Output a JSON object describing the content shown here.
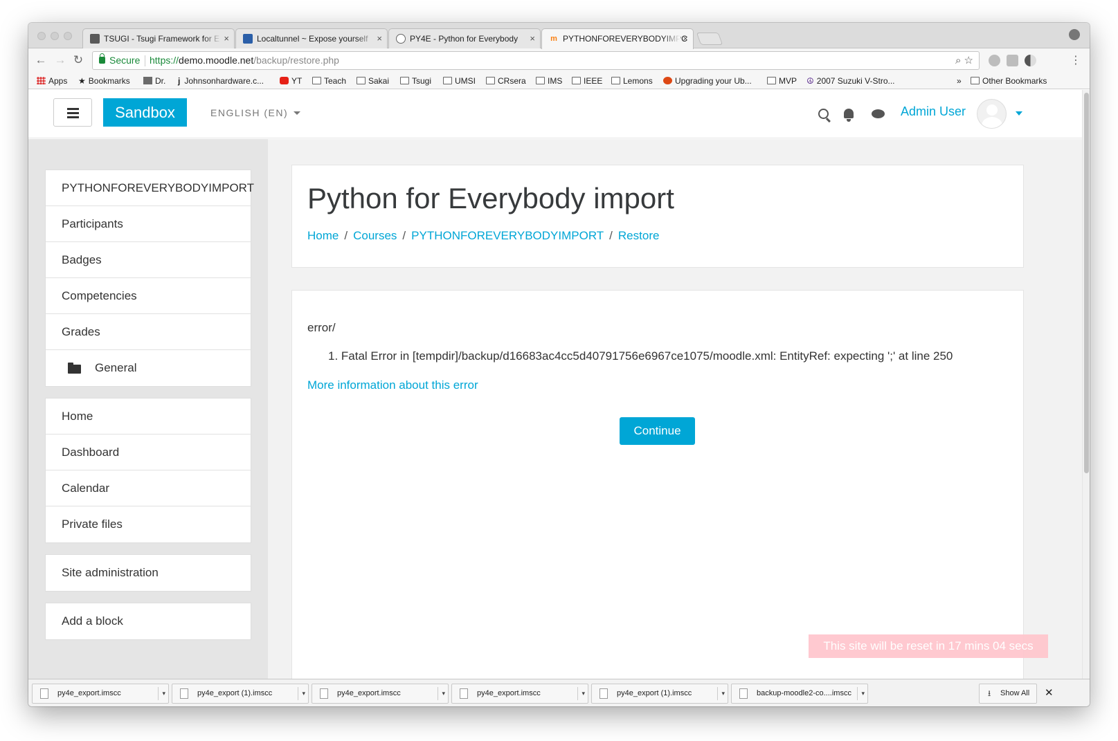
{
  "browser": {
    "tabs": [
      {
        "title": "TSUGI - Tsugi Framework for E",
        "favicon_color": "#5a5a5a"
      },
      {
        "title": "Localtunnel ~ Expose yourself",
        "favicon_color": "#2b5fa8"
      },
      {
        "title": "PY4E - Python for Everybody",
        "favicon_color": "#666666"
      },
      {
        "title": "PYTHONFOREVERYBODYIMPC",
        "favicon_color": "#f98012"
      }
    ],
    "close_glyph": "×",
    "nav": {
      "back": "←",
      "forward": "→",
      "reload": "↻"
    },
    "secure_label": "Secure",
    "url": {
      "scheme": "https://",
      "host": "demo.moodle.net",
      "path": "/backup/restore.php"
    },
    "omni_icons": "⌕ ☆",
    "kebab": "⋮",
    "bookmarks": [
      {
        "label": "Apps",
        "icon": "apps-icon"
      },
      {
        "label": "Bookmarks",
        "icon": "star-icon"
      },
      {
        "label": "Dr.",
        "icon": "photo-icon"
      },
      {
        "label": "Johnsonhardware.c...",
        "icon": "j-icon"
      },
      {
        "label": "YT",
        "icon": "youtube-icon"
      },
      {
        "label": "Teach",
        "icon": "folder-icon"
      },
      {
        "label": "Sakai",
        "icon": "folder-icon"
      },
      {
        "label": "Tsugi",
        "icon": "folder-icon"
      },
      {
        "label": "UMSI",
        "icon": "folder-icon"
      },
      {
        "label": "CRsera",
        "icon": "folder-icon"
      },
      {
        "label": "IMS",
        "icon": "folder-icon"
      },
      {
        "label": "IEEE",
        "icon": "folder-icon"
      },
      {
        "label": "Lemons",
        "icon": "folder-icon"
      },
      {
        "label": "Upgrading your Ub...",
        "icon": "ubuntu-icon"
      },
      {
        "label": "MVP",
        "icon": "folder-icon"
      },
      {
        "label": "2007 Suzuki V-Stro...",
        "icon": "peace-icon"
      }
    ],
    "bookmarks_overflow": "»",
    "other_bookmarks": "Other Bookmarks"
  },
  "moodle": {
    "brand": "Sandbox",
    "language": "ENGLISH (EN)",
    "user_name": "Admin User",
    "colors": {
      "accent": "#00a6d6",
      "reset_banner": "#ffc7ce"
    },
    "course_nav": [
      "PYTHONFOREVERYBODYIMPORT",
      "Participants",
      "Badges",
      "Competencies",
      "Grades",
      "General"
    ],
    "site_nav": [
      "Home",
      "Dashboard",
      "Calendar",
      "Private files"
    ],
    "site_admin": "Site administration",
    "add_block": "Add a block"
  },
  "main": {
    "title": "Python for Everybody import",
    "breadcrumb": [
      "Home",
      "Courses",
      "PYTHONFOREVERYBODYIMPORT",
      "Restore"
    ],
    "breadcrumb_separator": "/",
    "error_label": "error/",
    "error_items": [
      "1. Fatal Error in [tempdir]/backup/d16683ac4cc5d40791756e6967ce1075/moodle.xml: EntityRef: expecting ';' at line 250"
    ],
    "more_info_link": "More information about this error",
    "continue_button": "Continue",
    "reset_notice": "This site will be reset in 17 mins 04 secs"
  },
  "downloads": {
    "items": [
      "py4e_export.imscc",
      "py4e_export (1).imscc",
      "py4e_export.imscc",
      "py4e_export.imscc",
      "py4e_export (1).imscc",
      "backup-moodle2-co....imscc"
    ],
    "arrow": "▾",
    "show_all": "Show All",
    "show_all_icon": "⭳",
    "close": "✕"
  }
}
